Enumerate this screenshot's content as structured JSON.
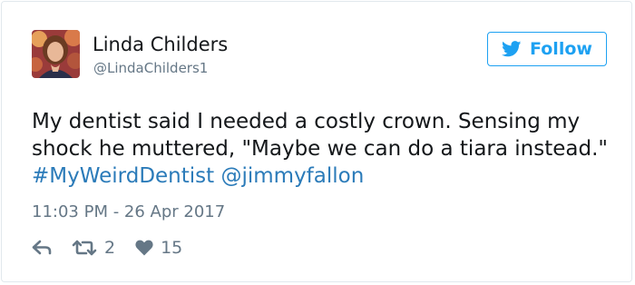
{
  "user": {
    "display_name": "Linda Childers",
    "handle": "@LindaChilders1"
  },
  "follow_button": {
    "label": "Follow",
    "icon": "twitter-bird-icon"
  },
  "tweet": {
    "text": "My dentist said I needed a costly crown. Sensing my shock he muttered, \"Maybe we can do a tiara instead.\"",
    "hashtag": "#MyWeirdDentist",
    "mention": "@jimmyfallon",
    "timestamp": "11:03 PM - 26 Apr 2017"
  },
  "actions": {
    "reply_icon": "reply-icon",
    "retweet_icon": "retweet-icon",
    "retweet_count": "2",
    "like_icon": "heart-icon",
    "like_count": "15"
  },
  "colors": {
    "link": "#2b7bb9",
    "accent": "#1da1f2",
    "text": "#14171a",
    "muted": "#657786"
  }
}
